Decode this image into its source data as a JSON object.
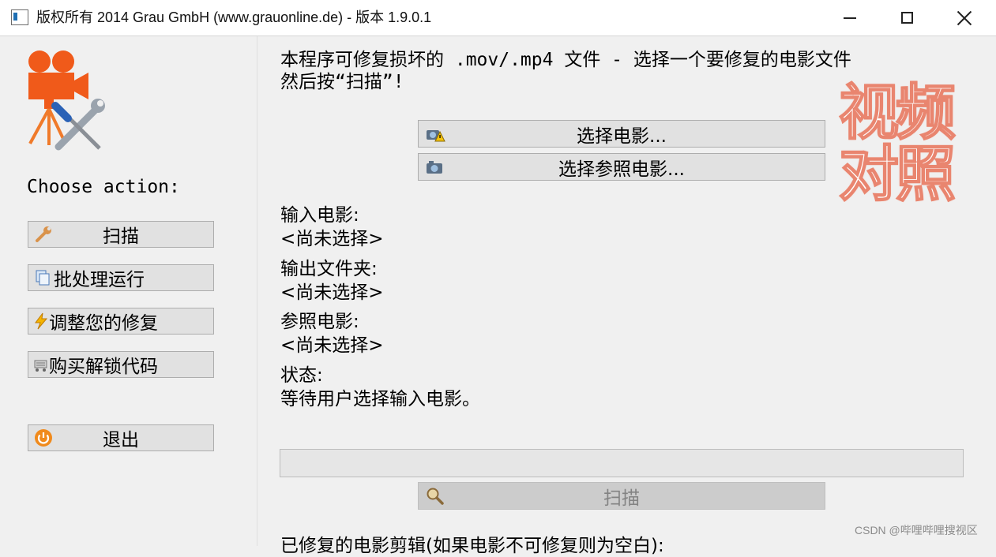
{
  "window": {
    "title": "版权所有 2014 Grau GmbH (www.grauonline.de) - 版本 1.9.0.1"
  },
  "sidebar": {
    "choose_label": "Choose action:",
    "buttons": [
      {
        "label": "扫描",
        "icon": "wrench-icon"
      },
      {
        "label": "批处理运行",
        "icon": "batch-pages-icon"
      },
      {
        "label": "调整您的修复",
        "icon": "lightning-icon"
      },
      {
        "label": "购买解锁代码",
        "icon": "cart-icon"
      },
      {
        "label": "退出",
        "icon": "power-icon"
      }
    ]
  },
  "main": {
    "intro_line1": "本程序可修复损坏的 .mov/.mp4 文件 - 选择一个要修复的电影文件",
    "intro_line2": "然后按“扫描”!",
    "select_movie_label": "选择电影...",
    "select_reference_label": "选择参照电影...",
    "input_movie_label": "输入电影:",
    "input_movie_value": "<尚未选择>",
    "output_folder_label": "输出文件夹:",
    "output_folder_value": "<尚未选择>",
    "reference_movie_label": "参照电影:",
    "reference_movie_value": "<尚未选择>",
    "status_label": "状态:",
    "status_value": "等待用户选择输入电影。",
    "scan_button_label": "扫描",
    "progress": 0,
    "repaired_clip_label": "已修复的电影剪辑(如果电影不可修复则为空白):"
  },
  "overlay": {
    "line1": "视频",
    "line2": "对照"
  },
  "watermark": "CSDN @哔哩哔哩搜视区",
  "colors": {
    "logo_orange": "#f05a1a",
    "overlay_outline": "#e9856f",
    "button_bg": "#e1e1e1"
  }
}
